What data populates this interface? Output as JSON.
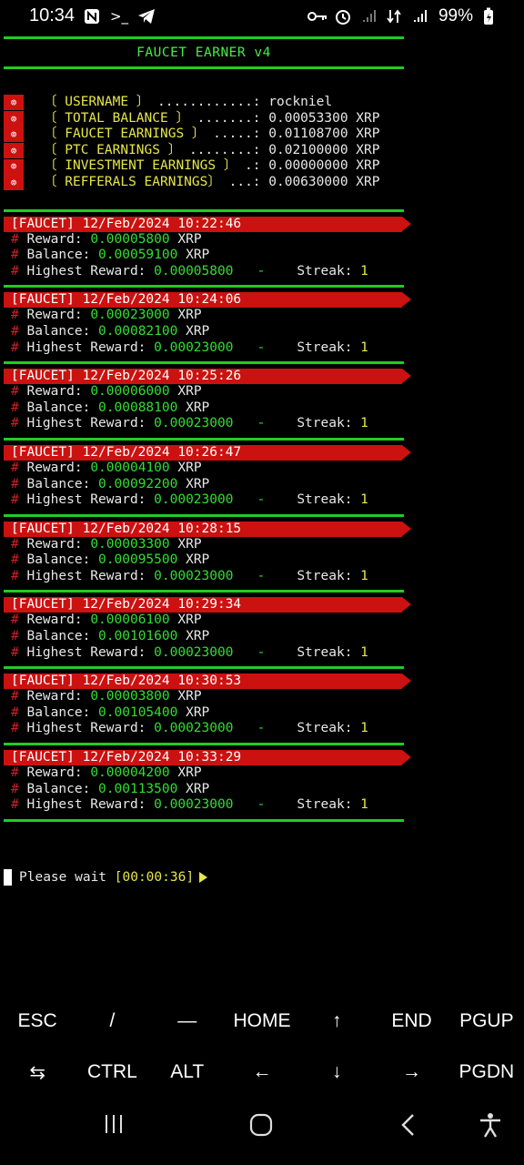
{
  "status_bar": {
    "time": "10:34",
    "battery": "99%",
    "icons_left": [
      "n-app-icon",
      "terminal-icon",
      "telegram-icon"
    ],
    "icons_right": [
      "key-icon",
      "alarm-icon",
      "signal-icon",
      "data-icon",
      "signal-icon-2",
      "battery-icon"
    ]
  },
  "terminal": {
    "title": "FAUCET EARNER v4",
    "info": [
      {
        "label": "〔 USERNAME 〕",
        "dots": " ............: ",
        "value": "rockniel"
      },
      {
        "label": "〔 TOTAL BALANCE 〕",
        "dots": " .......: ",
        "value": "0.00053300 XRP"
      },
      {
        "label": "〔 FAUCET EARNINGS 〕",
        "dots": " .....: ",
        "value": "0.01108700 XRP"
      },
      {
        "label": "〔 PTC EARNINGS 〕",
        "dots": " ........: ",
        "value": "0.02100000 XRP"
      },
      {
        "label": "〔 INVESTMENT EARNINGS 〕",
        "dots": " .: ",
        "value": "0.00000000 XRP"
      },
      {
        "label": "〔 REFFERALS EARNINGS〕",
        "dots": " ...: ",
        "value": "0.00630000 XRP"
      }
    ],
    "labels": {
      "reward": "Reward: ",
      "balance": "Balance: ",
      "highest": "Highest Reward: ",
      "streak": "Streak: ",
      "unit": " XRP",
      "dash": "   -    "
    },
    "entries": [
      {
        "header": "[FAUCET] 12/Feb/2024 10:22:46",
        "reward": "0.00005800",
        "balance": "0.00059100",
        "highest": "0.00005800",
        "streak": "1"
      },
      {
        "header": "[FAUCET] 12/Feb/2024 10:24:06",
        "reward": "0.00023000",
        "balance": "0.00082100",
        "highest": "0.00023000",
        "streak": "1"
      },
      {
        "header": "[FAUCET] 12/Feb/2024 10:25:26",
        "reward": "0.00006000",
        "balance": "0.00088100",
        "highest": "0.00023000",
        "streak": "1"
      },
      {
        "header": "[FAUCET] 12/Feb/2024 10:26:47",
        "reward": "0.00004100",
        "balance": "0.00092200",
        "highest": "0.00023000",
        "streak": "1"
      },
      {
        "header": "[FAUCET] 12/Feb/2024 10:28:15",
        "reward": "0.00003300",
        "balance": "0.00095500",
        "highest": "0.00023000",
        "streak": "1"
      },
      {
        "header": "[FAUCET] 12/Feb/2024 10:29:34",
        "reward": "0.00006100",
        "balance": "0.00101600",
        "highest": "0.00023000",
        "streak": "1"
      },
      {
        "header": "[FAUCET] 12/Feb/2024 10:30:53",
        "reward": "0.00003800",
        "balance": "0.00105400",
        "highest": "0.00023000",
        "streak": "1"
      },
      {
        "header": "[FAUCET] 12/Feb/2024 10:33:29",
        "reward": "0.00004200",
        "balance": "0.00113500",
        "highest": "0.00023000",
        "streak": "1"
      }
    ],
    "wait_text": "Please wait ",
    "wait_timer": "[00:00:36]"
  },
  "keyboard": {
    "row1": [
      "ESC",
      "/",
      "—",
      "HOME",
      "↑",
      "END",
      "PGUP"
    ],
    "row2": [
      "⇆",
      "CTRL",
      "ALT",
      "←",
      "↓",
      "→",
      "PGDN"
    ]
  },
  "colors": {
    "accent_green": "#22cc22",
    "header_red": "#cc1111",
    "label_yellow": "#e6e64a"
  }
}
